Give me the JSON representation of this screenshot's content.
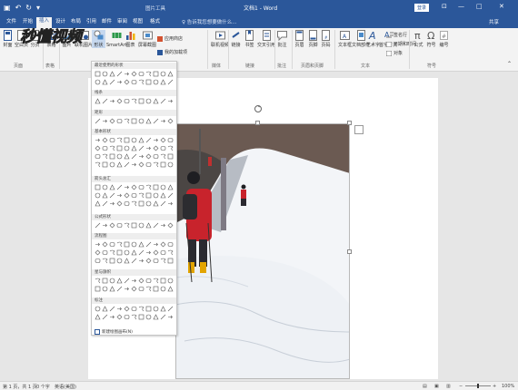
{
  "window": {
    "doc_title": "文档1 - Word",
    "picture_tools": "图片工具",
    "login": "登录",
    "share": "共享",
    "tell_me": "♀ 告诉我您想要做什么..."
  },
  "tabs": [
    "文件",
    "开始",
    "插入",
    "设计",
    "布局",
    "引用",
    "邮件",
    "审阅",
    "视图",
    "格式"
  ],
  "active_tab": "插入",
  "ribbon": {
    "buttons": [
      "封面",
      "空白页",
      "分页",
      "表格",
      "图片",
      "联机图片",
      "形状",
      "SmartArt",
      "图表",
      "屏幕截图",
      "联机视频",
      "链接",
      "书签",
      "交叉引用",
      "批注",
      "页眉",
      "页脚",
      "页码",
      "文本框",
      "文档部件",
      "艺术字",
      "首字下沉",
      "公式",
      "符号",
      "编号"
    ],
    "small": [
      "应用商店",
      "我的加载项",
      "签名行",
      "日期和时间",
      "对象"
    ],
    "groups": [
      "页面",
      "表格",
      "媒体",
      "链接",
      "批注",
      "页眉和页脚",
      "文本",
      "符号"
    ]
  },
  "dropdown": {
    "sections": [
      "最近使用的形状",
      "线条",
      "矩形",
      "基本形状",
      "箭头总汇",
      "公式形状",
      "流程图",
      "星与旗帜",
      "标注"
    ],
    "new_canvas": "新建绘图画布(N)"
  },
  "status": {
    "page": "第 1 页，共 1 页",
    "words": "0 个字",
    "language": "英语(美国)",
    "zoom": "100%"
  },
  "watermark": "秒懂视频",
  "colors": {
    "accent": "#2b579a",
    "ribbon": "#f3f3f3"
  }
}
